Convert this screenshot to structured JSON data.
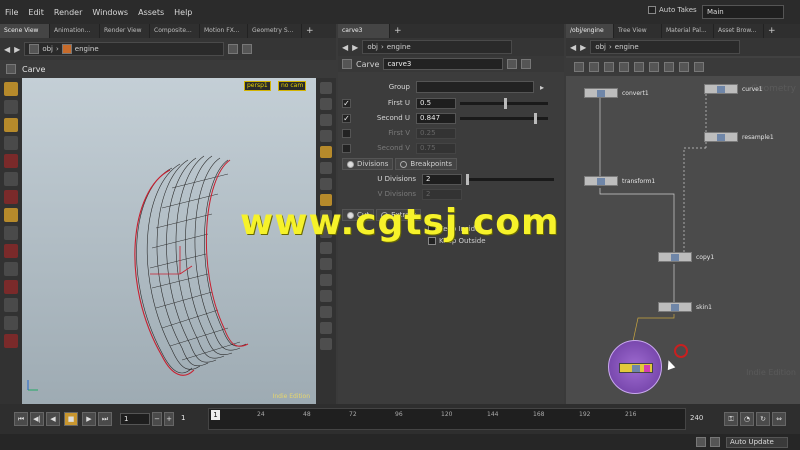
{
  "menu": {
    "items": [
      "File",
      "Edit",
      "Render",
      "Windows",
      "Assets",
      "Help"
    ],
    "auto_takes": "Auto Takes",
    "desktop": "Main"
  },
  "left_tabs": [
    "Scene View",
    "Animation...",
    "Render View",
    "Composite...",
    "Motion FX...",
    "Geometry S..."
  ],
  "mid_tabs": [
    "carve3"
  ],
  "right_tabs": [
    "/obj/engine",
    "Tree View",
    "Material Pal...",
    "Asset Brow..."
  ],
  "path": {
    "obj": "obj",
    "engine": "engine"
  },
  "viewport": {
    "title": "Carve",
    "cam1": "persp1",
    "cam2": "no cam",
    "edition": "Indie Edition"
  },
  "params": {
    "type": "Carve",
    "node": "carve3",
    "group_label": "Group",
    "first_u_label": "First U",
    "first_u": "0.5",
    "second_u_label": "Second U",
    "second_u": "0.847",
    "first_v_label": "First V",
    "first_v": "0.25",
    "second_v_label": "Second V",
    "second_v": "0.75",
    "tab_divisions": "Divisions",
    "tab_breakpoints": "Breakpoints",
    "u_div_label": "U Divisions",
    "u_div": "2",
    "v_div_label": "V Divisions",
    "v_div": "2",
    "cut": "Cut",
    "extract": "Extract",
    "keep_inside": "Keep Inside",
    "keep_outside": "Keep Outside"
  },
  "network": {
    "nodes": [
      "convert1",
      "curve1",
      "resample1",
      "transform1",
      "copy1",
      "skin1"
    ],
    "watermark": "Geometry",
    "edition": "Indie Edition"
  },
  "timeline": {
    "frame": "1",
    "start": "1",
    "end": "1",
    "ticks": [
      "24",
      "48",
      "72",
      "96",
      "120",
      "144",
      "168",
      "192",
      "216"
    ],
    "end_frame": "240",
    "current": "1"
  },
  "status": {
    "auto_update": "Auto Update"
  },
  "overlay": {
    "watermark": "www.cgtsj.com"
  }
}
